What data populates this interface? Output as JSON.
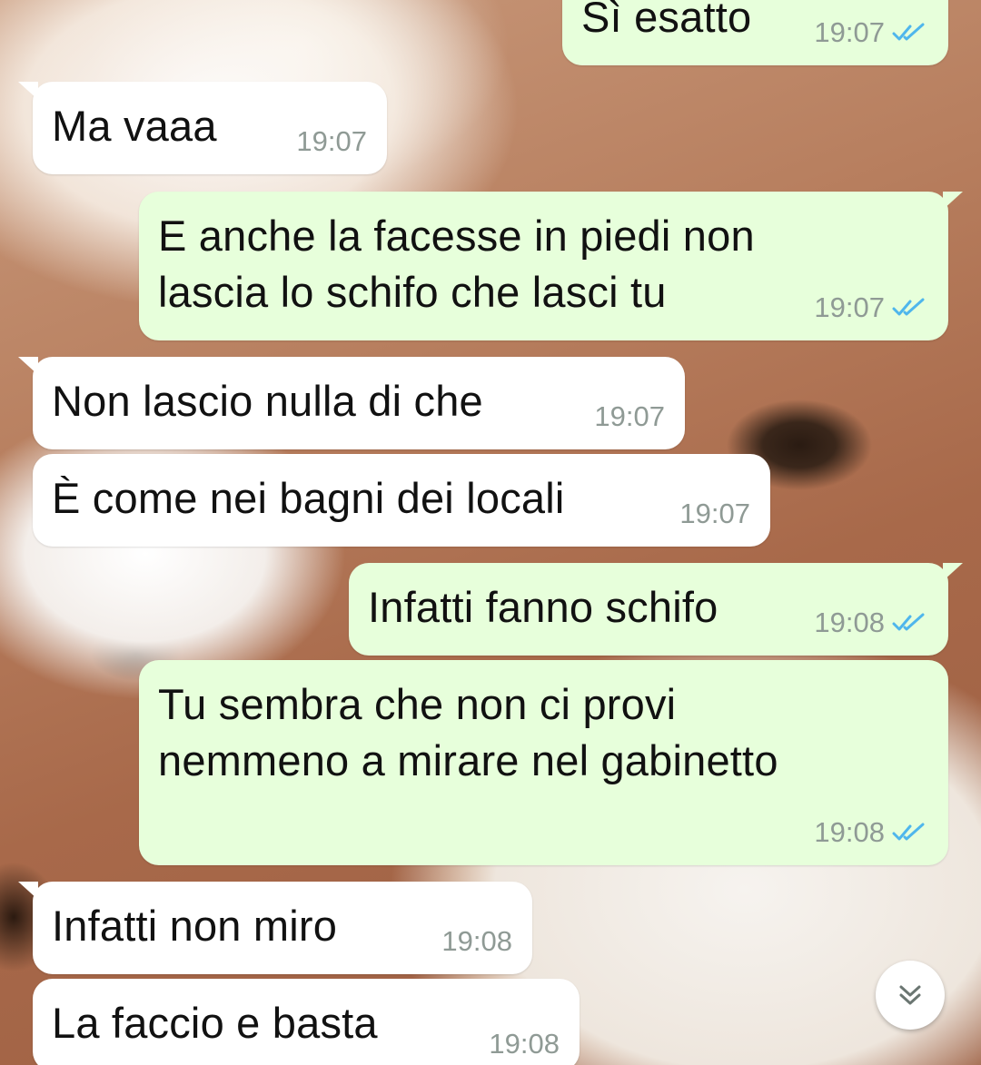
{
  "chat": {
    "messages": [
      {
        "direction": "outgoing",
        "text": "Sì esatto",
        "time": "19:07",
        "status": "read"
      },
      {
        "direction": "incoming",
        "text": "Ma vaaa",
        "time": "19:07"
      },
      {
        "direction": "outgoing",
        "text": "E anche la facesse in piedi non\nlascia lo schifo che lasci tu",
        "time": "19:07",
        "status": "read"
      },
      {
        "direction": "incoming",
        "text": "Non lascio nulla di che",
        "time": "19:07"
      },
      {
        "direction": "incoming",
        "text": "È come nei bagni dei locali",
        "time": "19:07"
      },
      {
        "direction": "outgoing",
        "text": "Infatti fanno schifo",
        "time": "19:08",
        "status": "read"
      },
      {
        "direction": "outgoing",
        "text": "Tu sembra che non ci provi\nnemmeno a mirare nel gabinetto",
        "time": "19:08",
        "status": "read"
      },
      {
        "direction": "incoming",
        "text": "Infatti non miro",
        "time": "19:08"
      },
      {
        "direction": "incoming",
        "text": "La faccio e basta",
        "time": "19:08"
      }
    ]
  },
  "colors": {
    "incoming_bubble": "#ffffff",
    "outgoing_bubble": "#e7ffdb",
    "read_ticks": "#4fb6ec",
    "timestamp": "#8f9a95"
  },
  "icons": {
    "read_receipt": "double-check-icon",
    "scroll_down": "double-chevron-down-icon"
  }
}
